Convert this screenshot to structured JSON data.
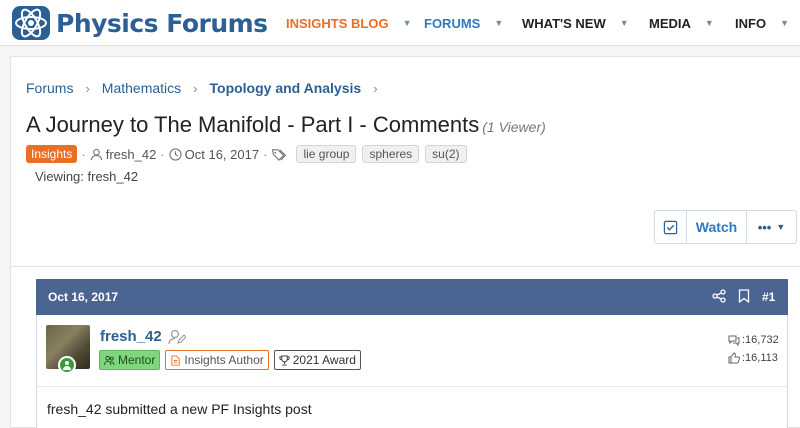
{
  "header": {
    "logo_text": "Physics Forums",
    "nav": [
      {
        "label": "INSIGHTS BLOG"
      },
      {
        "label": "FORUMS"
      },
      {
        "label": "WHAT'S NEW"
      },
      {
        "label": "MEDIA"
      },
      {
        "label": "INFO"
      }
    ],
    "colors": {
      "brand": "#2c5f94",
      "accent": "#e86f23",
      "link": "#2c7cbf"
    }
  },
  "breadcrumb": [
    "Forums",
    "Mathematics",
    "Topology and Analysis"
  ],
  "thread": {
    "title": "A Journey to The Manifold - Part I - Comments",
    "viewer_count": "(1 Viewer)",
    "prefix": "Insights",
    "author": "fresh_42",
    "date": "Oct 16, 2017",
    "tags": [
      "lie group",
      "spheres",
      "su(2)"
    ],
    "viewing": "Viewing: fresh_42"
  },
  "actions": {
    "watch_label": "Watch",
    "more_label": "•••"
  },
  "post": {
    "date": "Oct 16, 2017",
    "number": "#1",
    "username": "fresh_42",
    "roles": [
      "Mentor",
      "Insights Author",
      "2021 Award"
    ],
    "messages": ":16,732",
    "reactions": ":16,113",
    "body": "fresh_42 submitted a new PF Insights post"
  }
}
